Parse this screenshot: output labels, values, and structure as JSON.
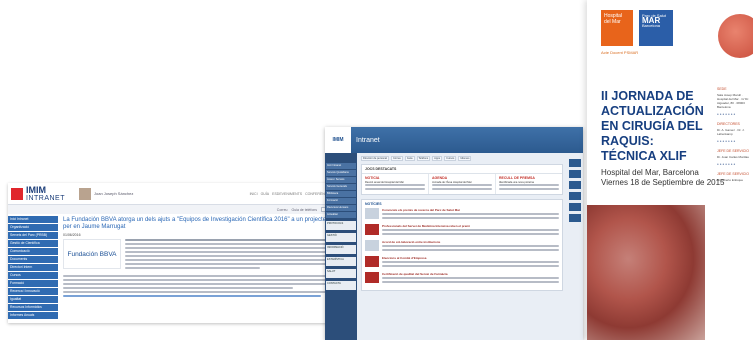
{
  "imim_intranet": {
    "logo": {
      "top": "IMIM",
      "bottom": "INTRANET"
    },
    "user_name": "Joan Joseph Sánchez",
    "header_links": [
      "INICI",
      "GUÍA",
      "ESDEVENIMENTS",
      "CONFERÈNCIES",
      "SERVEIS"
    ],
    "toolbar": {
      "item_a": "Correu",
      "item_b": "Guia de telèfons",
      "search_placeholder": "Cerca a la intranet"
    },
    "sidebar": [
      "Inici Intranet",
      "Organització",
      "Serveis del Parc (PRBB)",
      "Gestió de Científica",
      "Comunicació",
      "Documents",
      "Directori Intern",
      "Cursos",
      "Formació",
      "Recerca i Innovació",
      "Igualtat",
      "Recursos Informàtics",
      "Informes Anuals",
      "Memòria",
      "Infraestructura"
    ],
    "article": {
      "title": "La Fundación BBVA atorga un dels ajuts a \"Equipos de Investigación Científica 2016\" a un projecte liderat per en Jaume Marrugat",
      "date": "01/06/2016",
      "logo_text": "Fundación BBVA"
    }
  },
  "intranet_home": {
    "header_title": "Intranet",
    "logo_text": "IMIM",
    "tabs": [
      "Directori de personal",
      "Correu",
      "Guía",
      "Telèfons",
      "Apps",
      "Cursos",
      "Idiomes",
      "Calendari"
    ],
    "sidebar": [
      "Inici Intranet",
      "Serveis Quotidians",
      "Àrees i Serveis",
      "Serveis Generals",
      "Biblioteca",
      "Formació",
      "Recursos Humans",
      "Actualitat"
    ],
    "promos": [
      "PROTOCOLS",
      "GESTIÓ",
      "INFORMACIÓ",
      "ESTADÍSTICA",
      "SALUT",
      "CONTACTA"
    ],
    "featured": {
      "heading": "JOCS DESTACATS",
      "columns": [
        {
          "head": "NOTICIA",
          "text": "Reunió anual del Hospital del Mar"
        },
        {
          "head": "AGENDA",
          "text": "Jornada de l'Àrea Hospital del Mar"
        },
        {
          "head": "RECULL DE PREMSA",
          "text": "Identificada una nova proteïna"
        }
      ]
    },
    "news_heading": "NOTÍCIES",
    "news_items": [
      "Convocats els premis de recerca del Parc de Salut Mar",
      "Professionals del Servei de Medicina Intensiva reben el premi",
      "Acord de col·laboració entre institucions",
      "Eleccions al Comitè d'Empresa",
      "Certificació de qualitat del Servei de Farmàcia"
    ]
  },
  "poster": {
    "logo_hospital": "Hospital del Mar",
    "logo_parc_top": "Parc de Salut",
    "logo_parc_main": "MAR",
    "logo_parc_bottom": "Barcelona",
    "logo_sub": "Acte Docent PSMAR",
    "title": "II JORNADA DE ACTUALIZACIÓN EN CIRUGÍA DEL RAQUIS: TÉCNICA XLIF",
    "place": "Hospital del Mar, Barcelona",
    "date": "Viernes 18 de Septiembre de 2015",
    "info": [
      {
        "label": "SEDE",
        "text": "Sala Josep Marull · Hospital del Mar · C/ Dr. Aiguader, 80 · 08003 Barcelona"
      },
      {
        "label": "DIRECTORES",
        "text": "Dr. A. Gamez · Dr. J. Lahenkamp"
      },
      {
        "label": "JEFE DE SERVICIO",
        "text": "Dr. Joan Carles Monllau"
      },
      {
        "label": "JEFE DE SERVICIO",
        "text": "Dr. Alberto Enfoque"
      }
    ]
  }
}
